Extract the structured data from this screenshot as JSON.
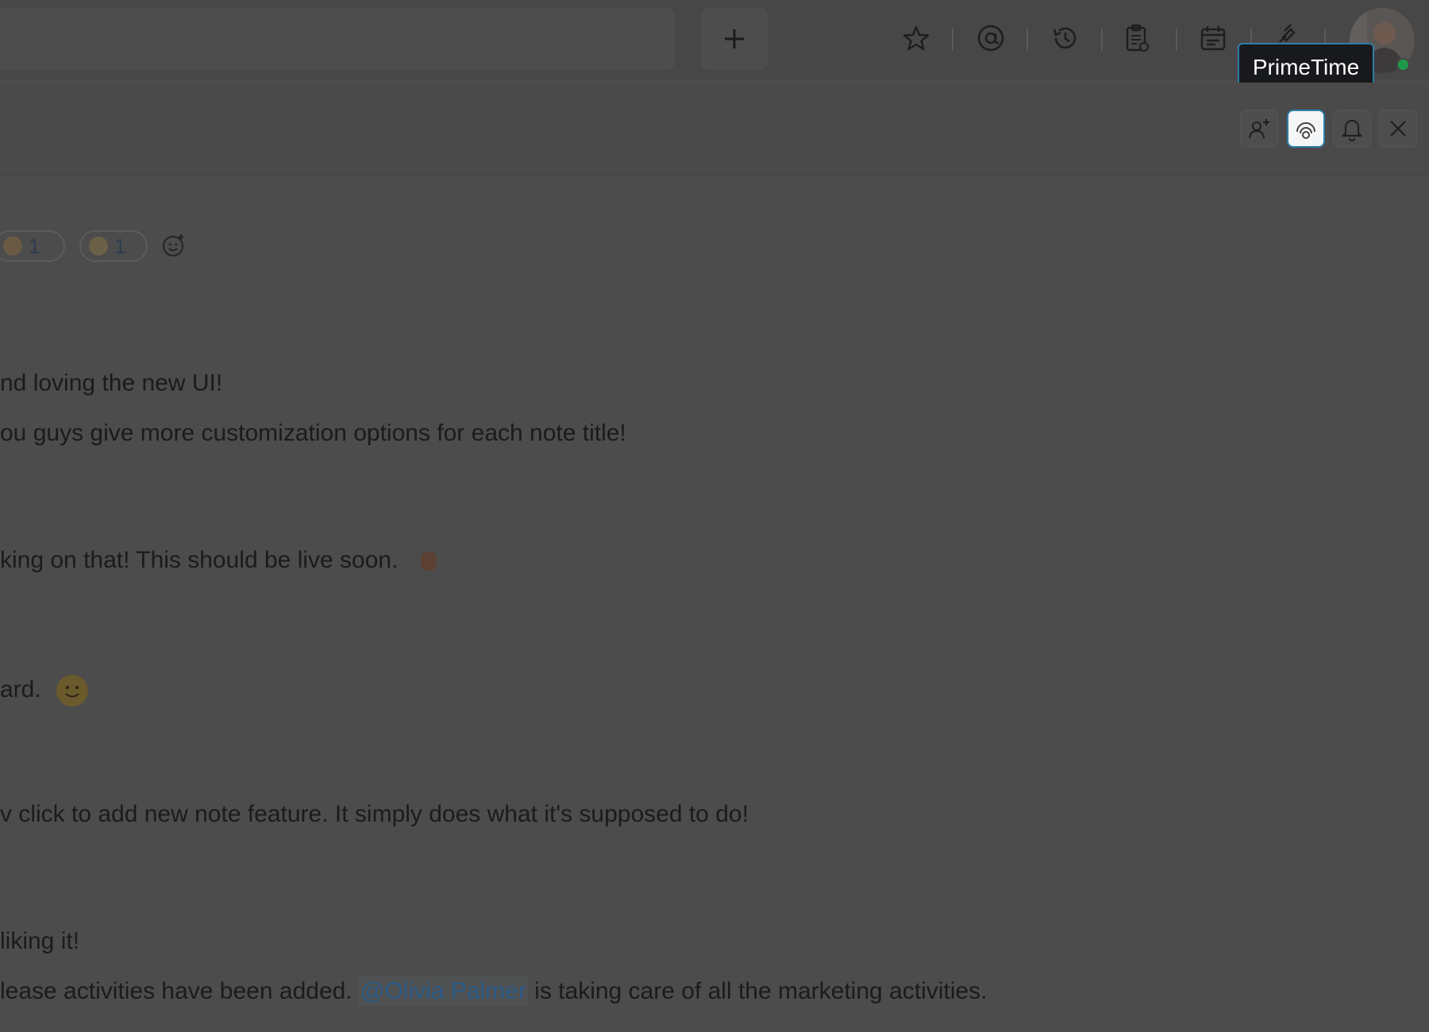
{
  "topbar": {
    "add_icon": "plus-icon",
    "icons": [
      "star-icon",
      "at-mention-icon",
      "history-icon",
      "clipboard-icon",
      "calendar-icon",
      "plug-icon"
    ]
  },
  "tooltip": {
    "text": "PrimeTime"
  },
  "header_actions": [
    "add-member-icon",
    "primetime-icon",
    "bell-icon",
    "close-icon"
  ],
  "reactions": [
    {
      "emoji": "clapping-hands",
      "count": "1"
    },
    {
      "emoji": "sparkler",
      "count": "1"
    }
  ],
  "messages": {
    "m1": "nd loving the new UI!",
    "m2": "ou guys give more customization options for each note title!",
    "m3": "king on that! This should be live soon.",
    "m4": "ard.",
    "m5": "v click to add new note feature. It simply does what it's supposed to do!",
    "m6": "liking it!",
    "m7_pre": "lease activities have been added.",
    "m7_mention": "@Olivia Palmer",
    "m7_post": "is taking care of all the marketing activities."
  },
  "colors": {
    "accent": "#2f7ea8",
    "online": "#1f9a4a",
    "overlay": "#4c4c4c"
  }
}
